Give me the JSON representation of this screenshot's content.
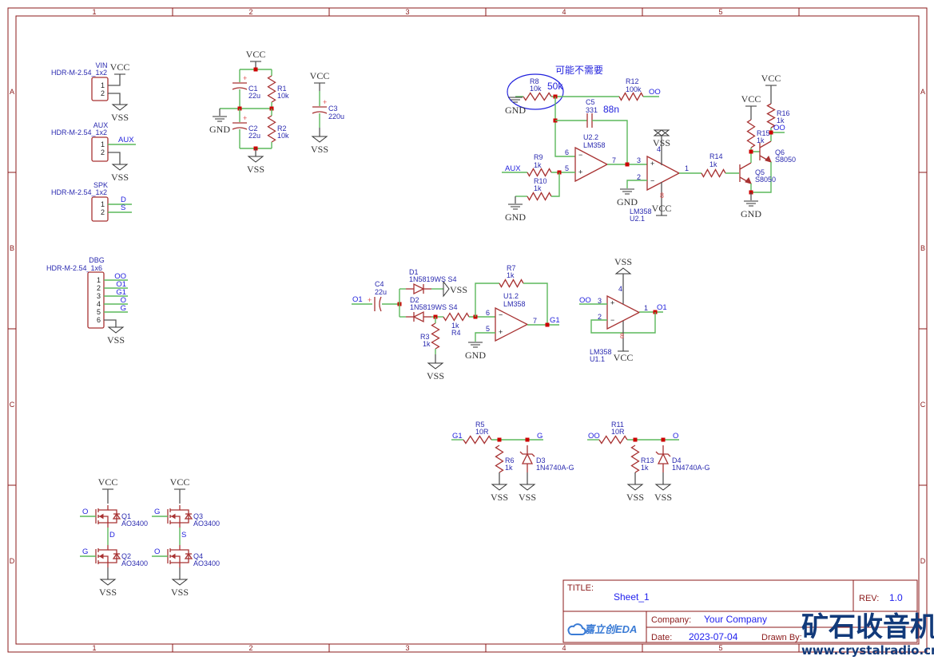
{
  "frame": {
    "columns": [
      "1",
      "2",
      "3",
      "4",
      "5"
    ],
    "rows": [
      "A",
      "B",
      "C",
      "D"
    ]
  },
  "power": {
    "vcc": "VCC",
    "vss": "VSS",
    "gnd": "GND"
  },
  "headers": {
    "VIN": {
      "name": "VIN",
      "footprint": "HDR-M-2.54_1x2",
      "pins": [
        "1",
        "2"
      ]
    },
    "AUX": {
      "name": "AUX",
      "footprint": "HDR-M-2.54_1x2",
      "pins": [
        "1",
        "2"
      ]
    },
    "SPK": {
      "name": "SPK",
      "footprint": "HDR-M-2.54_1x2",
      "pins": [
        "1",
        "2"
      ]
    },
    "DBG": {
      "name": "DBG",
      "footprint": "HDR-M-2.54_1x6",
      "pins": [
        "1",
        "2",
        "3",
        "4",
        "5",
        "6"
      ]
    }
  },
  "nets": {
    "aux": "AUX",
    "d": "D",
    "s": "S",
    "oo": "OO",
    "o1": "O1",
    "g1": "G1",
    "o": "O",
    "g": "G"
  },
  "components": {
    "C1": {
      "ref": "C1",
      "value": "22u"
    },
    "C2": {
      "ref": "C2",
      "value": "22u"
    },
    "C3": {
      "ref": "C3",
      "value": "220u"
    },
    "C4": {
      "ref": "C4",
      "value": "22u"
    },
    "C5": {
      "ref": "C5",
      "value": "331"
    },
    "R1": {
      "ref": "R1",
      "value": "10k"
    },
    "R2": {
      "ref": "R2",
      "value": "10k"
    },
    "R3": {
      "ref": "R3",
      "value": "1k"
    },
    "R4": {
      "ref": "R4",
      "value": "1k"
    },
    "R5": {
      "ref": "R5",
      "value": "10R"
    },
    "R6": {
      "ref": "R6",
      "value": "1k"
    },
    "R7": {
      "ref": "R7",
      "value": "1k"
    },
    "R8": {
      "ref": "R8",
      "value": "10k"
    },
    "R9": {
      "ref": "R9",
      "value": "1k"
    },
    "R10": {
      "ref": "R10",
      "value": "1k"
    },
    "R11": {
      "ref": "R11",
      "value": "10R"
    },
    "R12": {
      "ref": "R12",
      "value": "100k"
    },
    "R13": {
      "ref": "R13",
      "value": "1k"
    },
    "R14": {
      "ref": "R14",
      "value": "1k"
    },
    "R15": {
      "ref": "R15",
      "value": "1k"
    },
    "R16": {
      "ref": "R16",
      "value": "1k"
    },
    "D1": {
      "ref": "D1",
      "value": "1N5819WS S4"
    },
    "D2": {
      "ref": "D2",
      "value": "1N5819WS S4"
    },
    "D3": {
      "ref": "D3",
      "value": "1N4740A-G"
    },
    "D4": {
      "ref": "D4",
      "value": "1N4740A-G"
    },
    "Q1": {
      "ref": "Q1",
      "value": "AO3400"
    },
    "Q2": {
      "ref": "Q2",
      "value": "AO3400"
    },
    "Q3": {
      "ref": "Q3",
      "value": "AO3400"
    },
    "Q4": {
      "ref": "Q4",
      "value": "AO3400"
    },
    "Q5": {
      "ref": "Q5",
      "value": "S8050"
    },
    "Q6": {
      "ref": "Q6",
      "value": "S8050"
    },
    "U2_2": {
      "ref": "U2.2",
      "value": "LM358",
      "pins": {
        "minus": "6",
        "plus": "5",
        "out": "7"
      }
    },
    "U2_1": {
      "ref": "U2.1",
      "value": "LM358",
      "pins": {
        "plus": "3",
        "minus": "2",
        "out": "1",
        "v_top": "4",
        "v_bot": "8"
      }
    },
    "U1_2": {
      "ref": "U1.2",
      "value": "LM358",
      "pins": {
        "minus": "6",
        "plus": "5",
        "out": "7"
      }
    },
    "U1_1": {
      "ref": "U1.1",
      "value": "LM358",
      "pins": {
        "plus": "3",
        "minus": "2",
        "out": "1",
        "v_top": "4",
        "v_bot": "8"
      }
    }
  },
  "annotations": {
    "note": "可能不需要",
    "r8_alt": "50k",
    "c5_alt": "88n"
  },
  "title_block": {
    "title_label": "TITLE:",
    "title": "Sheet_1",
    "rev_label": "REV:",
    "rev": "1.0",
    "company_label": "Company:",
    "company": "Your Company",
    "date_label": "Date:",
    "date": "2023-07-04",
    "drawn_by_label": "Drawn By:",
    "logo": "嘉立创EDA"
  },
  "watermark": {
    "text": "矿石收音机",
    "url": "www.crystalradio.cn"
  },
  "colors": {
    "wire": "#5cb85c",
    "component": "#a83232",
    "label": "#2222dd",
    "junction": "#cc0000",
    "frame": "#8b1a1a"
  }
}
